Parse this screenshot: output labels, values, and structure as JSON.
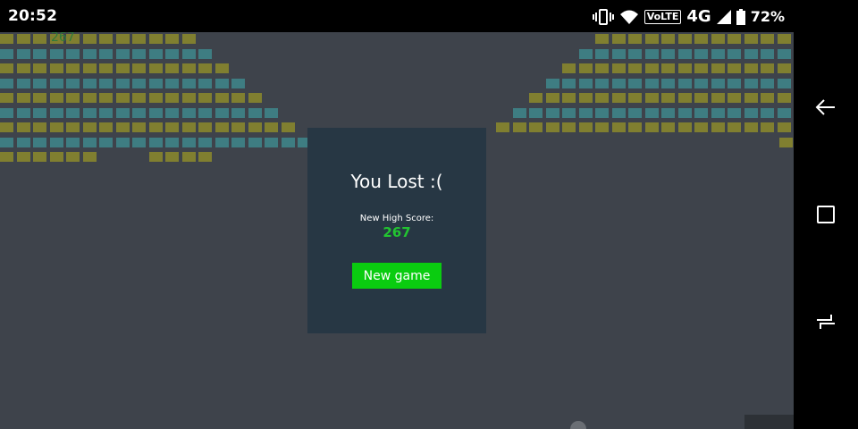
{
  "status_bar": {
    "time": "20:52",
    "network": "4G",
    "volte": "VoLTE",
    "battery": "72%",
    "icons": [
      "vibrate-icon",
      "wifi-icon",
      "volte-icon",
      "signal-icon",
      "battery-icon"
    ]
  },
  "game": {
    "score": "267",
    "brick_colors": {
      "olive": "#807f30",
      "teal": "#3e7d82"
    },
    "background": "#3e434b"
  },
  "modal": {
    "title": "You Lost :(",
    "high_score_label": "New High Score:",
    "high_score_value": "267",
    "button_label": "New game",
    "button_color": "#0acc10",
    "background": "#273744"
  },
  "nav_bar": {
    "buttons": [
      "back-icon",
      "recents-icon",
      "switch-apps-icon"
    ]
  }
}
